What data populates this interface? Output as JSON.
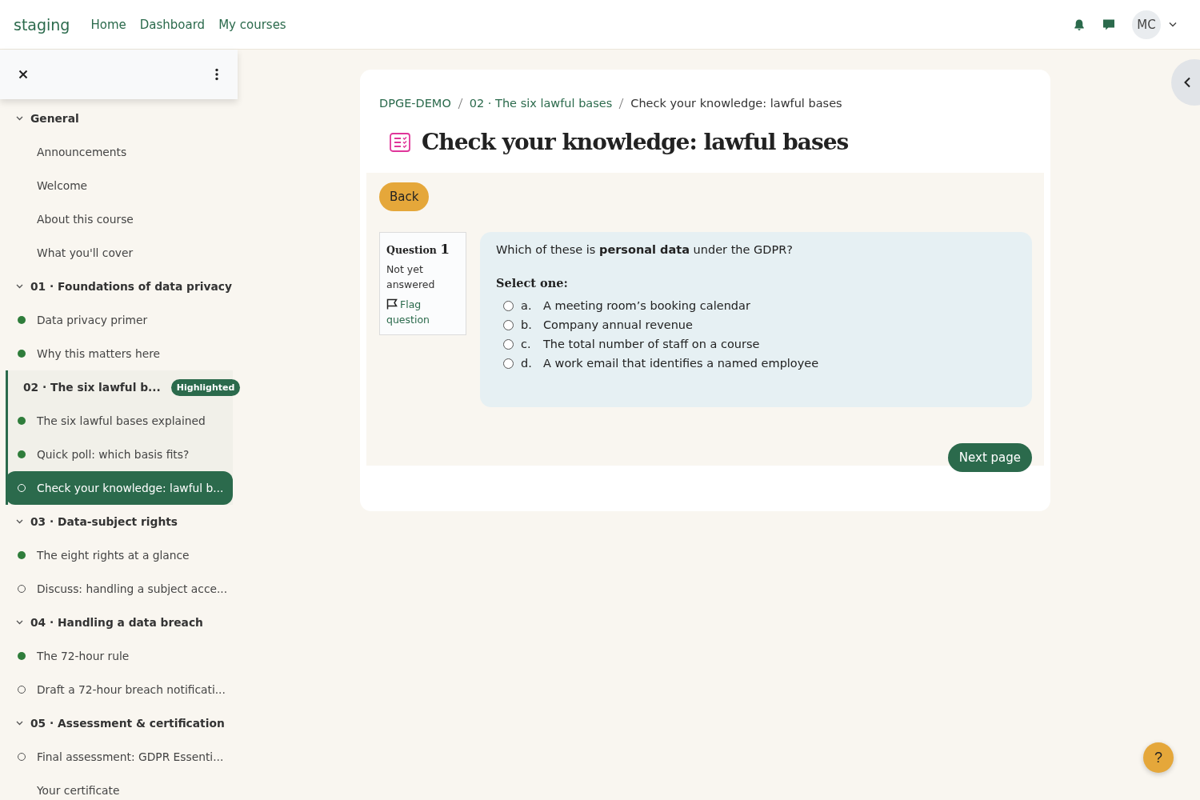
{
  "navbar": {
    "site_name": "staging",
    "links": [
      "Home",
      "Dashboard",
      "My courses"
    ],
    "avatar_initials": "MC"
  },
  "course_index": {
    "items": [
      {
        "kind": "section",
        "label": "General",
        "highlighted": false
      },
      {
        "kind": "plain",
        "label": "Announcements",
        "selected": false
      },
      {
        "kind": "plain",
        "label": "Welcome",
        "selected": false
      },
      {
        "kind": "plain",
        "label": "About this course",
        "selected": false
      },
      {
        "kind": "plain",
        "label": "What you'll cover",
        "selected": false
      },
      {
        "kind": "section",
        "label": "01 · Foundations of data privacy",
        "highlighted": false
      },
      {
        "kind": "complete",
        "label": "Data privacy primer",
        "selected": false
      },
      {
        "kind": "complete",
        "label": "Why this matters here",
        "selected": false
      },
      {
        "kind": "section",
        "label": "02 · The six lawful b...",
        "highlighted": true,
        "badge": "Highlighted"
      },
      {
        "kind": "complete",
        "label": "The six lawful bases explained",
        "selected": false
      },
      {
        "kind": "complete",
        "label": "Quick poll: which basis fits?",
        "selected": false
      },
      {
        "kind": "incomplete",
        "label": "Check your knowledge: lawful b...",
        "selected": true
      },
      {
        "kind": "section",
        "label": "03 · Data-subject rights",
        "highlighted": false
      },
      {
        "kind": "complete",
        "label": "The eight rights at a glance",
        "selected": false
      },
      {
        "kind": "incomplete",
        "label": "Discuss: handling a subject acce...",
        "selected": false
      },
      {
        "kind": "section",
        "label": "04 · Handling a data breach",
        "highlighted": false
      },
      {
        "kind": "complete",
        "label": "The 72-hour rule",
        "selected": false
      },
      {
        "kind": "incomplete",
        "label": "Draft a 72-hour breach notificati...",
        "selected": false
      },
      {
        "kind": "section",
        "label": "05 · Assessment & certification",
        "highlighted": false
      },
      {
        "kind": "incomplete",
        "label": "Final assessment: GDPR Essenti...",
        "selected": false
      },
      {
        "kind": "plain",
        "label": "Your certificate",
        "selected": false
      }
    ]
  },
  "breadcrumb": [
    {
      "label": "DPGE-DEMO",
      "link": true
    },
    {
      "label": "02 · The six lawful bases",
      "link": true
    },
    {
      "label": "Check your knowledge: lawful bases",
      "link": false
    }
  ],
  "page_title": "Check your knowledge: lawful bases",
  "back_button": "Back",
  "question_info": {
    "label": "Question",
    "number": "1",
    "state": "Not yet answered",
    "flag_label": "Flag question",
    "flagged": false
  },
  "question": {
    "text": "Which of these is **personal data** under the GDPR?",
    "prompt": "Select one:",
    "options": [
      {
        "letter": "a.",
        "text": "A meeting room’s booking calendar",
        "selected": false
      },
      {
        "letter": "b.",
        "text": "Company annual revenue",
        "selected": false
      },
      {
        "letter": "c.",
        "text": "The total number of staff on a course",
        "selected": false
      },
      {
        "letter": "d.",
        "text": "A work email that identifies a named employee",
        "selected": false
      }
    ]
  },
  "next_button": "Next page",
  "help_button": "?"
}
